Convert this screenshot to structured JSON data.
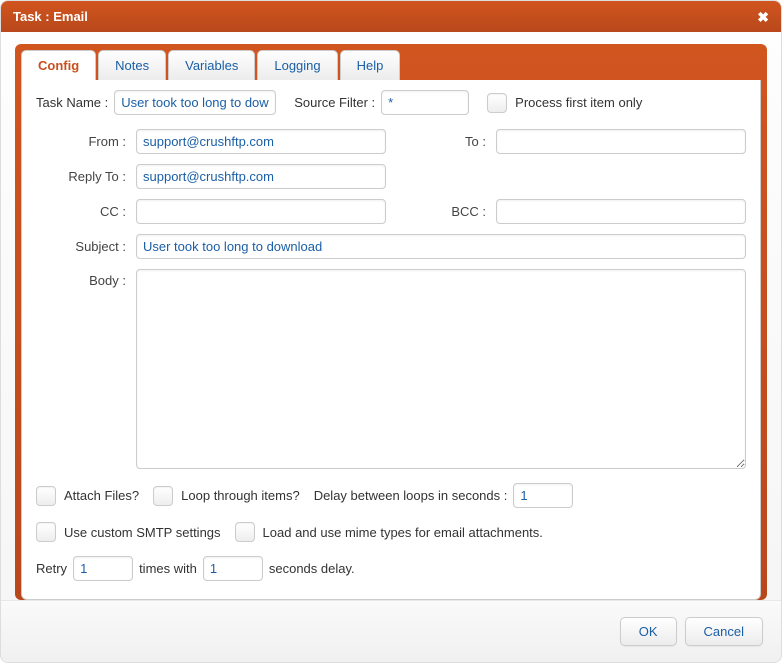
{
  "window": {
    "title": "Task : Email"
  },
  "tabs": [
    {
      "label": "Config",
      "active": true
    },
    {
      "label": "Notes",
      "active": false
    },
    {
      "label": "Variables",
      "active": false
    },
    {
      "label": "Logging",
      "active": false
    },
    {
      "label": "Help",
      "active": false
    }
  ],
  "top": {
    "task_name_label": "Task Name :",
    "task_name_value": "User took too long to dow",
    "source_filter_label": "Source Filter :",
    "source_filter_value": "*",
    "process_first_label": "Process first item only"
  },
  "form": {
    "from_label": "From :",
    "from_value": "support@crushftp.com",
    "to_label": "To :",
    "to_value": "",
    "reply_to_label": "Reply To :",
    "reply_to_value": "support@crushftp.com",
    "cc_label": "CC :",
    "cc_value": "",
    "bcc_label": "BCC :",
    "bcc_value": "",
    "subject_label": "Subject :",
    "subject_value": "User took too long to download",
    "body_label": "Body :",
    "body_value": ""
  },
  "options": {
    "attach_files_label": "Attach Files?",
    "loop_label": "Loop through items?",
    "delay_label": "Delay between loops in seconds :",
    "delay_value": "1",
    "custom_smtp_label": "Use custom SMTP settings",
    "mime_label": "Load and use mime types for email attachments.",
    "retry_prefix": "Retry",
    "retry_times_value": "1",
    "retry_mid": "times with",
    "retry_seconds_value": "1",
    "retry_suffix": "seconds delay."
  },
  "buttons": {
    "ok": "OK",
    "cancel": "Cancel"
  }
}
